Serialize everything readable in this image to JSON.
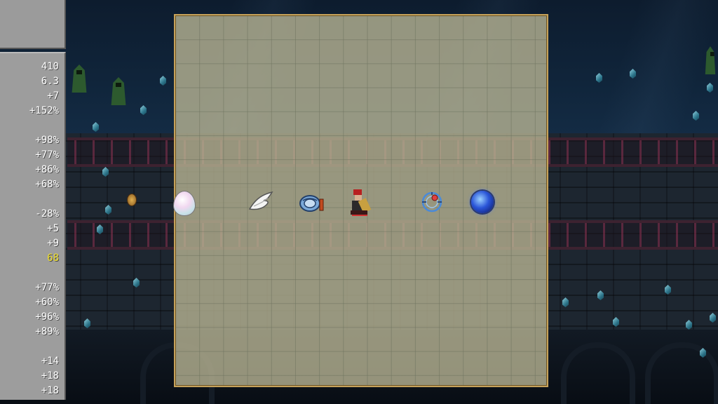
{
  "stats": [
    {
      "value": "410",
      "highlight": false
    },
    {
      "value": "6.3",
      "highlight": false
    },
    {
      "value": "+7",
      "highlight": false
    },
    {
      "value": "+152%",
      "highlight": false
    },
    {
      "value": "+98%",
      "highlight": false
    },
    {
      "value": "+77%",
      "highlight": false
    },
    {
      "value": "+86%",
      "highlight": false
    },
    {
      "value": "+68%",
      "highlight": false
    },
    {
      "value": "-28%",
      "highlight": false
    },
    {
      "value": "+5",
      "highlight": false
    },
    {
      "value": "+9",
      "highlight": false
    },
    {
      "value": "68",
      "highlight": true
    },
    {
      "value": "+77%",
      "highlight": false
    },
    {
      "value": "+60%",
      "highlight": false
    },
    {
      "value": "+96%",
      "highlight": false
    },
    {
      "value": "+89%",
      "highlight": false
    },
    {
      "value": "+14",
      "highlight": false
    },
    {
      "value": "+18",
      "highlight": false
    },
    {
      "value": "+18",
      "highlight": false
    }
  ],
  "items": [
    {
      "name": "egg-icon"
    },
    {
      "name": "wings-icon"
    },
    {
      "name": "bracer-icon"
    },
    {
      "name": "player-character"
    },
    {
      "name": "attractorb-icon"
    },
    {
      "name": "blue-orb-icon"
    }
  ],
  "colors": {
    "stat_text": "#ffffff",
    "stat_highlight": "#f0e030",
    "grid_border": "#c6a25a",
    "grid_fill": "#b8b494"
  }
}
